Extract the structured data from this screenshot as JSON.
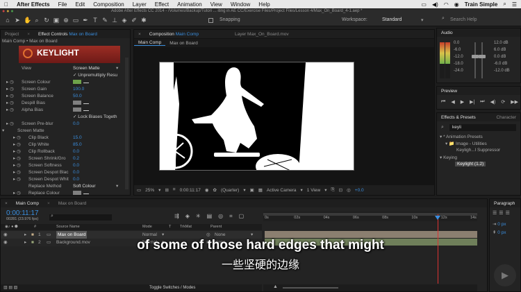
{
  "menubar": {
    "apple": "",
    "app": "After Effects",
    "items": [
      "File",
      "Edit",
      "Composition",
      "Layer",
      "Effect",
      "Animation",
      "View",
      "Window",
      "Help"
    ],
    "brand": "Train Simple"
  },
  "toolbar": {
    "doc_title": "Adobe After Effects CC 2014 - /Volumes/Backup/Tutori ... iting in AE CC/Exercise Files/Project Files/Lesson 4/Max_On_Board_4-1.aep *",
    "snapping": "Snapping",
    "workspace_label": "Workspace:",
    "workspace_value": "Standard",
    "search_placeholder": "Search Help"
  },
  "project_panel": {
    "tab_project": "Project",
    "tab_effect_controls": "Effect Controls",
    "tab_effect_controls_target": "Max on Board",
    "breadcrumb": "Main Comp • Max on Board",
    "logo": "KEYLIGHT"
  },
  "effect_rows": [
    {
      "label": "View",
      "value": "Screen Matte",
      "indent": 16,
      "kind": "dropdown"
    },
    {
      "label": "",
      "value": "✓ Unpremultiply Resu",
      "indent": 16,
      "kind": "check"
    },
    {
      "label": "Screen Colour",
      "value": "",
      "indent": 16,
      "kind": "swatch"
    },
    {
      "label": "Screen Gain",
      "value": "100.0",
      "indent": 16,
      "kind": "num"
    },
    {
      "label": "Screen Balance",
      "value": "50.0",
      "indent": 16,
      "kind": "num"
    },
    {
      "label": "Despill Bias",
      "value": "",
      "indent": 16,
      "kind": "swatch-gray"
    },
    {
      "label": "Alpha Bias",
      "value": "",
      "indent": 16,
      "kind": "swatch-gray"
    },
    {
      "label": "",
      "value": "✓ Lock Biases Togeth",
      "indent": 16,
      "kind": "check"
    },
    {
      "label": "Screen Pre-blur",
      "value": "0.0",
      "indent": 16,
      "kind": "num"
    },
    {
      "label": "Screen Matte",
      "value": "",
      "indent": 10,
      "kind": "group"
    },
    {
      "label": "Clip Black",
      "value": "15.0",
      "indent": 26,
      "kind": "num"
    },
    {
      "label": "Clip White",
      "value": "85.0",
      "indent": 26,
      "kind": "num"
    },
    {
      "label": "Clip Rollback",
      "value": "0.0",
      "indent": 26,
      "kind": "num"
    },
    {
      "label": "Screen Shrink/Gro",
      "value": "0.2",
      "indent": 26,
      "kind": "num"
    },
    {
      "label": "Screen Softness",
      "value": "0.0",
      "indent": 26,
      "kind": "num"
    },
    {
      "label": "Screen Despot Blac",
      "value": "0.0",
      "indent": 26,
      "kind": "num"
    },
    {
      "label": "Screen Despot Whit",
      "value": "0.0",
      "indent": 26,
      "kind": "num"
    },
    {
      "label": "Replace Method",
      "value": "Soft Colour",
      "indent": 26,
      "kind": "dropdown"
    },
    {
      "label": "Replace Colour",
      "value": "",
      "indent": 26,
      "kind": "swatch-gray"
    }
  ],
  "composition": {
    "tab_label": "Composition",
    "tab_target": "Main Comp",
    "layer_tab": "Layer  Max_On_Board.mov",
    "subtab_active": "Main Comp",
    "subtab_2": "Max on Board",
    "zoom": "25%",
    "timecode": "0:00:11:17",
    "resolution": "(Quarter)",
    "camera": "Active Camera",
    "views": "1 View",
    "exposure": "+0.0"
  },
  "audio": {
    "tab": "Audio",
    "left_scale": [
      "0.0",
      "-6.0",
      "-12.0",
      "-18.0",
      "-24.0"
    ],
    "right_scale": [
      "12.0 dB",
      "6.0 dB",
      "0.0 dB",
      "-6.0 dB",
      "-12.0 dB"
    ]
  },
  "preview": {
    "tab": "Preview"
  },
  "effects_presets": {
    "tab": "Effects & Presets",
    "tab_character": "Character",
    "search": "keyli",
    "tree": [
      {
        "label": "▾ * Animation Presets",
        "indent": 4
      },
      {
        "label": "▾ 📁 Image - Utilities",
        "indent": 12
      },
      {
        "label": "Keyligh...l Suppressor",
        "indent": 28
      },
      {
        "label": "▾ Keying",
        "indent": 4
      },
      {
        "label": "Keylight (1.2)",
        "indent": 26,
        "highlight": true
      }
    ]
  },
  "paragraph": {
    "tab": "Paragraph",
    "field1": "0 px",
    "field2": "0 px"
  },
  "timeline": {
    "tab_main": "Main Comp",
    "tab_2": "Max on Board",
    "timecode": "0:00:11:17",
    "frames": "00281 (23.976 fps)",
    "col_source": "Source Name",
    "col_mode": "Mode",
    "col_t": "T",
    "col_trkmat": "TrkMat",
    "col_parent": "Parent",
    "layers": [
      {
        "num": "1",
        "name": "Max on Board",
        "mode": "Normal",
        "parent": "None"
      },
      {
        "num": "2",
        "name": "Background.mov",
        "mode": "Normal",
        "parent": "None"
      }
    ],
    "ruler": [
      "0s",
      "02s",
      "04s",
      "06s",
      "08s",
      "10s",
      "12s",
      "14s"
    ],
    "toggle": "Toggle Switches / Modes"
  },
  "subtitles": {
    "en": "of some of those hard edges that might",
    "zh": "一些坚硬的边缘"
  }
}
